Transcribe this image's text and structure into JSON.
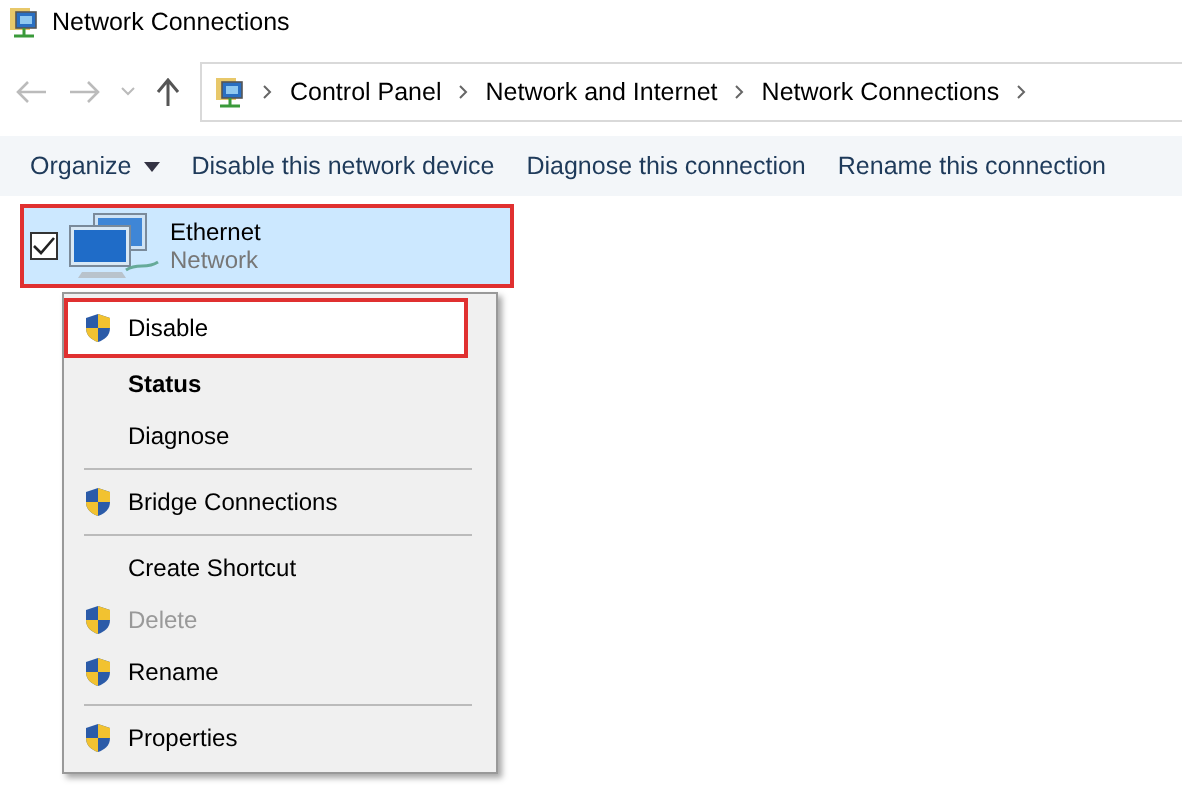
{
  "window": {
    "title": "Network Connections"
  },
  "address_bar": {
    "breadcrumbs": [
      "Control Panel",
      "Network and Internet",
      "Network Connections"
    ]
  },
  "toolbar": [
    {
      "label": "Organize",
      "kind": "dropdown"
    },
    {
      "label": "Disable this network device",
      "kind": "button"
    },
    {
      "label": "Diagnose this connection",
      "kind": "button"
    },
    {
      "label": "Rename this connection",
      "kind": "button"
    }
  ],
  "connection": {
    "name": "Ethernet",
    "status": "Network",
    "checked": true,
    "selected": true,
    "annotated": true
  },
  "context_menu": [
    {
      "kind": "item",
      "label": "Disable",
      "shield": true,
      "bold": false,
      "disabled": false,
      "annotated": true
    },
    {
      "kind": "item",
      "label": "Status",
      "shield": false,
      "bold": true,
      "disabled": false,
      "annotated": false
    },
    {
      "kind": "item",
      "label": "Diagnose",
      "shield": false,
      "bold": false,
      "disabled": false,
      "annotated": false
    },
    {
      "kind": "separator"
    },
    {
      "kind": "item",
      "label": "Bridge Connections",
      "shield": true,
      "bold": false,
      "disabled": false,
      "annotated": false
    },
    {
      "kind": "separator"
    },
    {
      "kind": "item",
      "label": "Create Shortcut",
      "shield": false,
      "bold": false,
      "disabled": false,
      "annotated": false
    },
    {
      "kind": "item",
      "label": "Delete",
      "shield": true,
      "bold": false,
      "disabled": true,
      "annotated": false
    },
    {
      "kind": "item",
      "label": "Rename",
      "shield": true,
      "bold": false,
      "disabled": false,
      "annotated": false
    },
    {
      "kind": "separator"
    },
    {
      "kind": "item",
      "label": "Properties",
      "shield": true,
      "bold": false,
      "disabled": false,
      "annotated": false
    }
  ]
}
